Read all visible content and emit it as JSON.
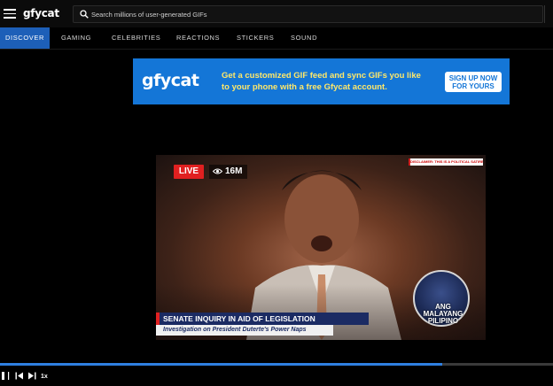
{
  "header": {
    "logo_text": "gfycat",
    "search_placeholder": "Search millions of user-generated GIFs"
  },
  "nav": {
    "tabs": [
      {
        "label": "DISCOVER",
        "active": true
      },
      {
        "label": "GAMING",
        "active": false
      },
      {
        "label": "CELEBRITIES",
        "active": false
      },
      {
        "label": "REACTIONS",
        "active": false
      },
      {
        "label": "STICKERS",
        "active": false
      },
      {
        "label": "SOUND",
        "active": false
      }
    ]
  },
  "ad": {
    "logo_text": "gfycat",
    "line1": "Get a customized GIF feed and sync GIFs you like",
    "line2": "to your phone with a free Gfycat account.",
    "button_line1": "SIGN UP NOW",
    "button_line2": "FOR YOURS",
    "background_color": "#1476d7",
    "text_color": "#ffe86a"
  },
  "video": {
    "live_label": "LIVE",
    "view_count": "16M",
    "disclaimer": "DISCLAIMER: THIS IS A POLITICAL SATIRE",
    "seal_line1": "ANG",
    "seal_line2": "MALAYANG",
    "seal_line3": "PILIPINO",
    "headline": "SENATE INQUIRY IN AID OF LEGISLATION",
    "subheadline": "Investigation on President Duterte's Power Naps"
  },
  "player": {
    "progress_fraction": 0.8,
    "speed_label": "1x",
    "accent_color": "#2f7fe0"
  }
}
